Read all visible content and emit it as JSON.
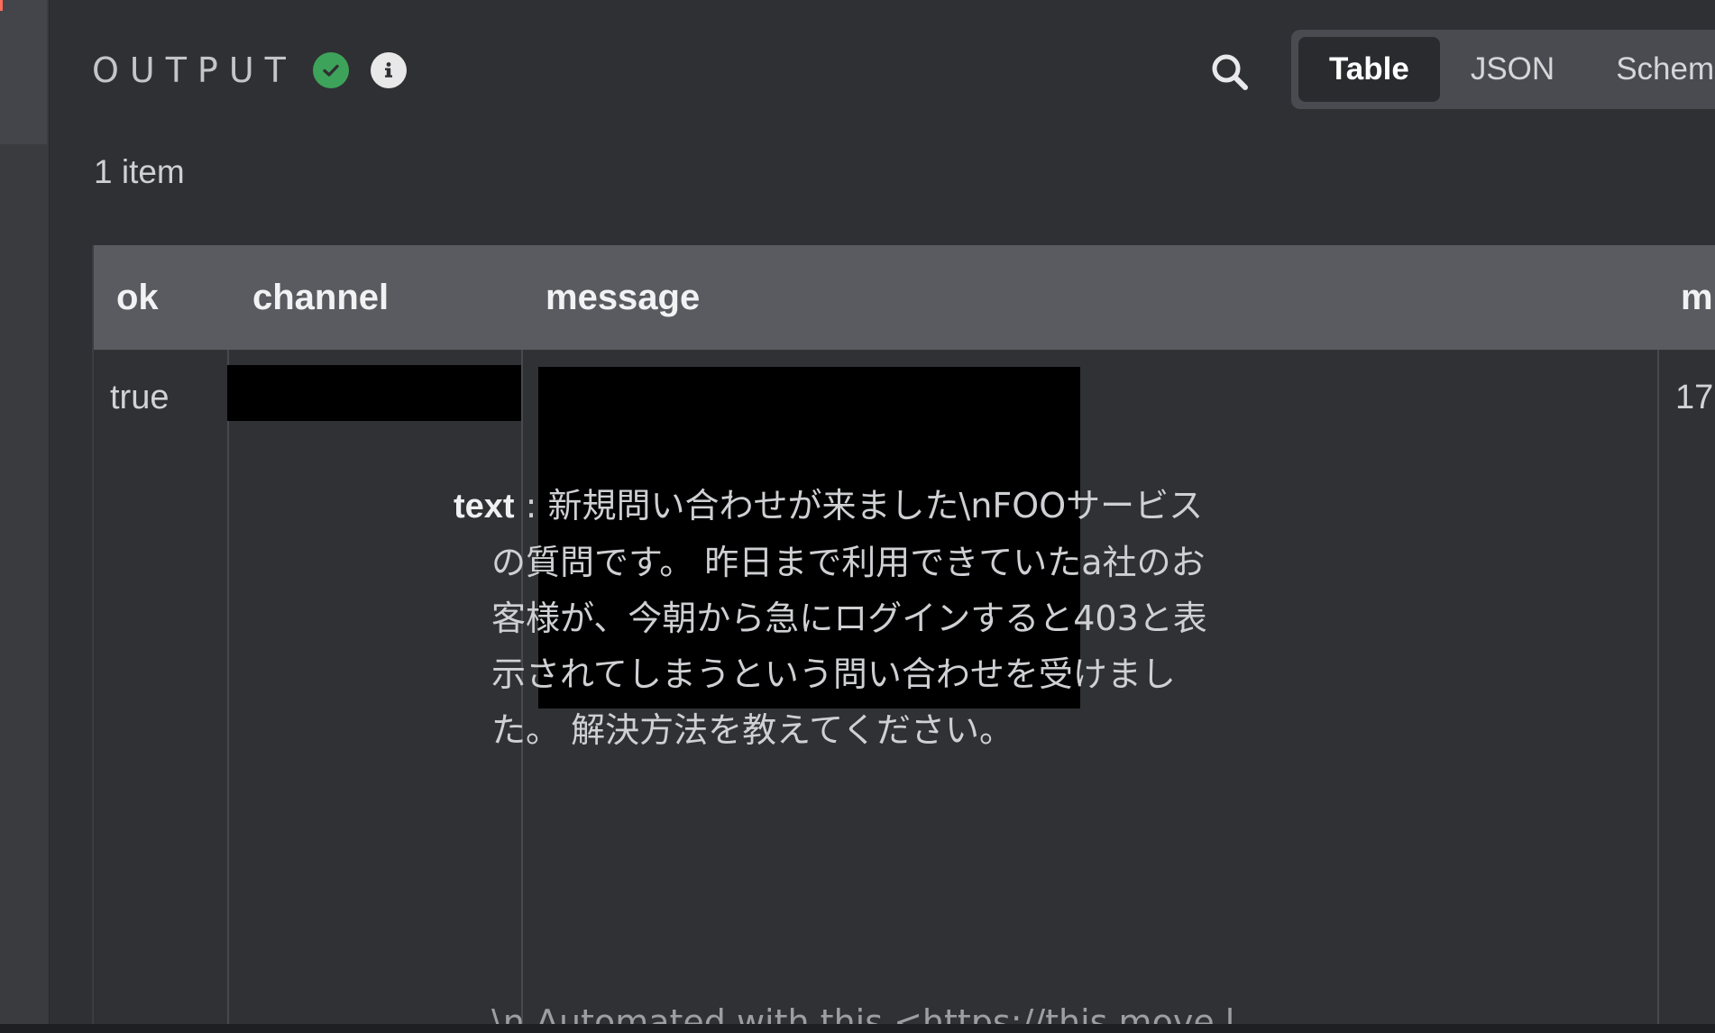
{
  "output": {
    "title": "OUTPUT",
    "status_icon": "check-circle-icon",
    "info_icon": "info-circle-icon",
    "status_color": "#3ea35a"
  },
  "toolbar": {
    "search_icon": "search-icon",
    "tabs": [
      {
        "label": "Table",
        "active": true
      },
      {
        "label": "JSON",
        "active": false
      },
      {
        "label": "Schem",
        "active": false
      }
    ]
  },
  "item_count": "1 item",
  "table": {
    "columns": [
      "ok",
      "channel",
      "message",
      "m"
    ],
    "row": {
      "ok": "true",
      "channel": "",
      "message": {
        "text_key": "text",
        "text_sep": " : ",
        "text_first": "新規問い合わせが来ました\\nFOOサービス",
        "text_lines": [
          "の質問です。 昨日まで利用できていたa社のお",
          "客様が、今朝から急にログインすると403と表",
          "示されてしまうという問い合わせを受けまし",
          "た。 解決方法を教えてください。"
        ],
        "text_cut": "\\n Automated with this  <https://this.move.l"
      },
      "m": "17"
    }
  }
}
